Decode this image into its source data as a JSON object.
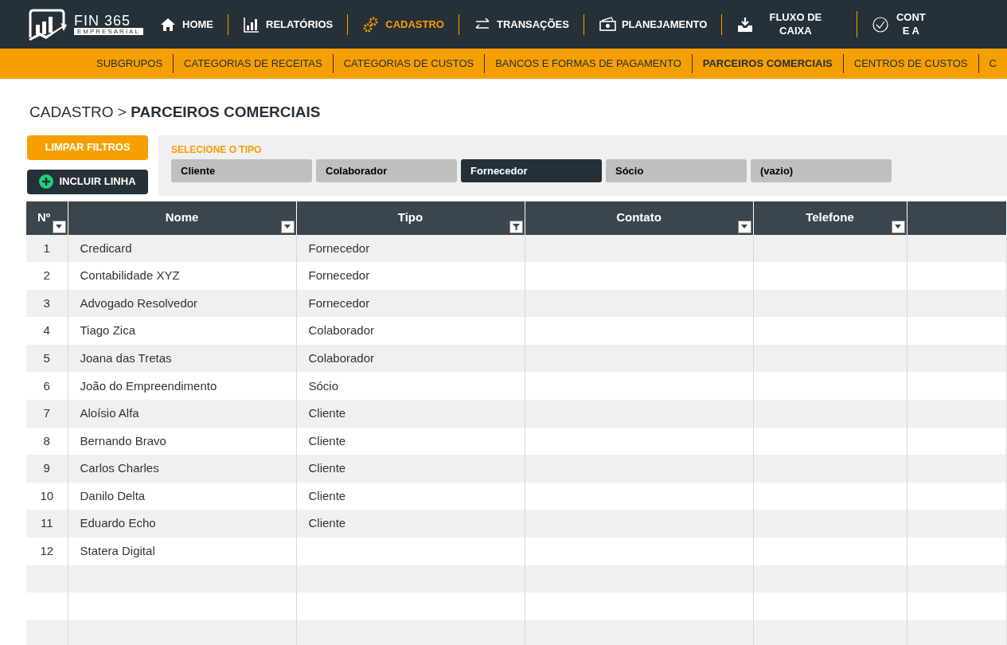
{
  "logo": {
    "title": "FIN 365",
    "subtitle": "EMPRESARIAL"
  },
  "nav": [
    {
      "label": "HOME",
      "selected": false
    },
    {
      "label": "RELATÓRIOS",
      "selected": false
    },
    {
      "label": "CADASTRO",
      "selected": true
    },
    {
      "label": "TRANSAÇÕES",
      "selected": false
    },
    {
      "label": "PLANEJAMENTO",
      "selected": false
    },
    {
      "label": "FLUXO DE CAIXA",
      "selected": false
    },
    {
      "label": "CONT E A",
      "selected": false
    }
  ],
  "subnav": [
    {
      "label": "SUBGRUPOS",
      "selected": false
    },
    {
      "label": "CATEGORIAS DE RECEITAS",
      "selected": false
    },
    {
      "label": "CATEGORIAS DE CUSTOS",
      "selected": false
    },
    {
      "label": "BANCOS E FORMAS DE PAGAMENTO",
      "selected": false
    },
    {
      "label": "PARCEIROS COMERCIAIS",
      "selected": true
    },
    {
      "label": "CENTROS DE CUSTOS",
      "selected": false
    },
    {
      "label": "C",
      "selected": false
    }
  ],
  "breadcrumb": {
    "parent": "CADASTRO >",
    "current": "PARCEIROS COMERCIAIS"
  },
  "buttons": {
    "clear": "LIMPAR FILTROS",
    "add": "INCLUIR LINHA"
  },
  "filter": {
    "title": "SELECIONE O TIPO",
    "options": [
      {
        "label": "Cliente",
        "selected": false
      },
      {
        "label": "Colaborador",
        "selected": false
      },
      {
        "label": "Fornecedor",
        "selected": true
      },
      {
        "label": "Sócio",
        "selected": false
      },
      {
        "label": "(vazio)",
        "selected": false
      }
    ]
  },
  "table": {
    "columns": [
      {
        "label": "Nº",
        "filtered": false
      },
      {
        "label": "Nome",
        "filtered": false
      },
      {
        "label": "Tipo",
        "filtered": true
      },
      {
        "label": "Contato",
        "filtered": false
      },
      {
        "label": "Telefone",
        "filtered": false
      }
    ],
    "rows": [
      [
        "1",
        "Credicard",
        "Fornecedor"
      ],
      [
        "2",
        "Contabilidade XYZ",
        "Fornecedor"
      ],
      [
        "3",
        "Advogado Resolvedor",
        "Fornecedor"
      ],
      [
        "4",
        "Tiago Zica",
        "Colaborador"
      ],
      [
        "5",
        "Joana  das Tretas",
        "Colaborador"
      ],
      [
        "6",
        "João do Empreendimento",
        "Sócio"
      ],
      [
        "7",
        "Aloísio Alfa",
        "Cliente"
      ],
      [
        "8",
        "Bernando Bravo",
        "Cliente"
      ],
      [
        "9",
        "Carlos Charles",
        "Cliente"
      ],
      [
        "10",
        "Danilo Delta",
        "Cliente"
      ],
      [
        "11",
        "Eduardo Echo",
        "Cliente"
      ],
      [
        "12",
        "Statera Digital"
      ]
    ]
  }
}
